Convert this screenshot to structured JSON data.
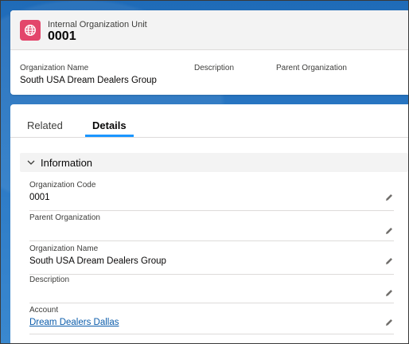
{
  "header": {
    "object_type": "Internal Organization Unit",
    "record_name": "0001",
    "icon": "org-unit-icon",
    "fields": [
      {
        "label": "Organization Name",
        "value": "South USA Dream Dealers Group"
      },
      {
        "label": "Description",
        "value": ""
      },
      {
        "label": "Parent Organization",
        "value": ""
      }
    ]
  },
  "tabs": [
    {
      "label": "Related",
      "active": false
    },
    {
      "label": "Details",
      "active": true
    }
  ],
  "section": {
    "title": "Information",
    "expanded": true
  },
  "fields": [
    {
      "label": "Organization Code",
      "value": "0001",
      "is_link": false
    },
    {
      "label": "Parent Organization",
      "value": "",
      "is_link": false
    },
    {
      "label": "Organization Name",
      "value": "South USA Dream Dealers Group",
      "is_link": false
    },
    {
      "label": "Description",
      "value": "",
      "is_link": false
    },
    {
      "label": "Account",
      "value": "Dream Dealers Dallas",
      "is_link": true
    }
  ],
  "colors": {
    "icon_bg": "#e3466b",
    "tab_active": "#1b96ff",
    "link": "#0b5cab",
    "background": "#1f6bb8"
  }
}
